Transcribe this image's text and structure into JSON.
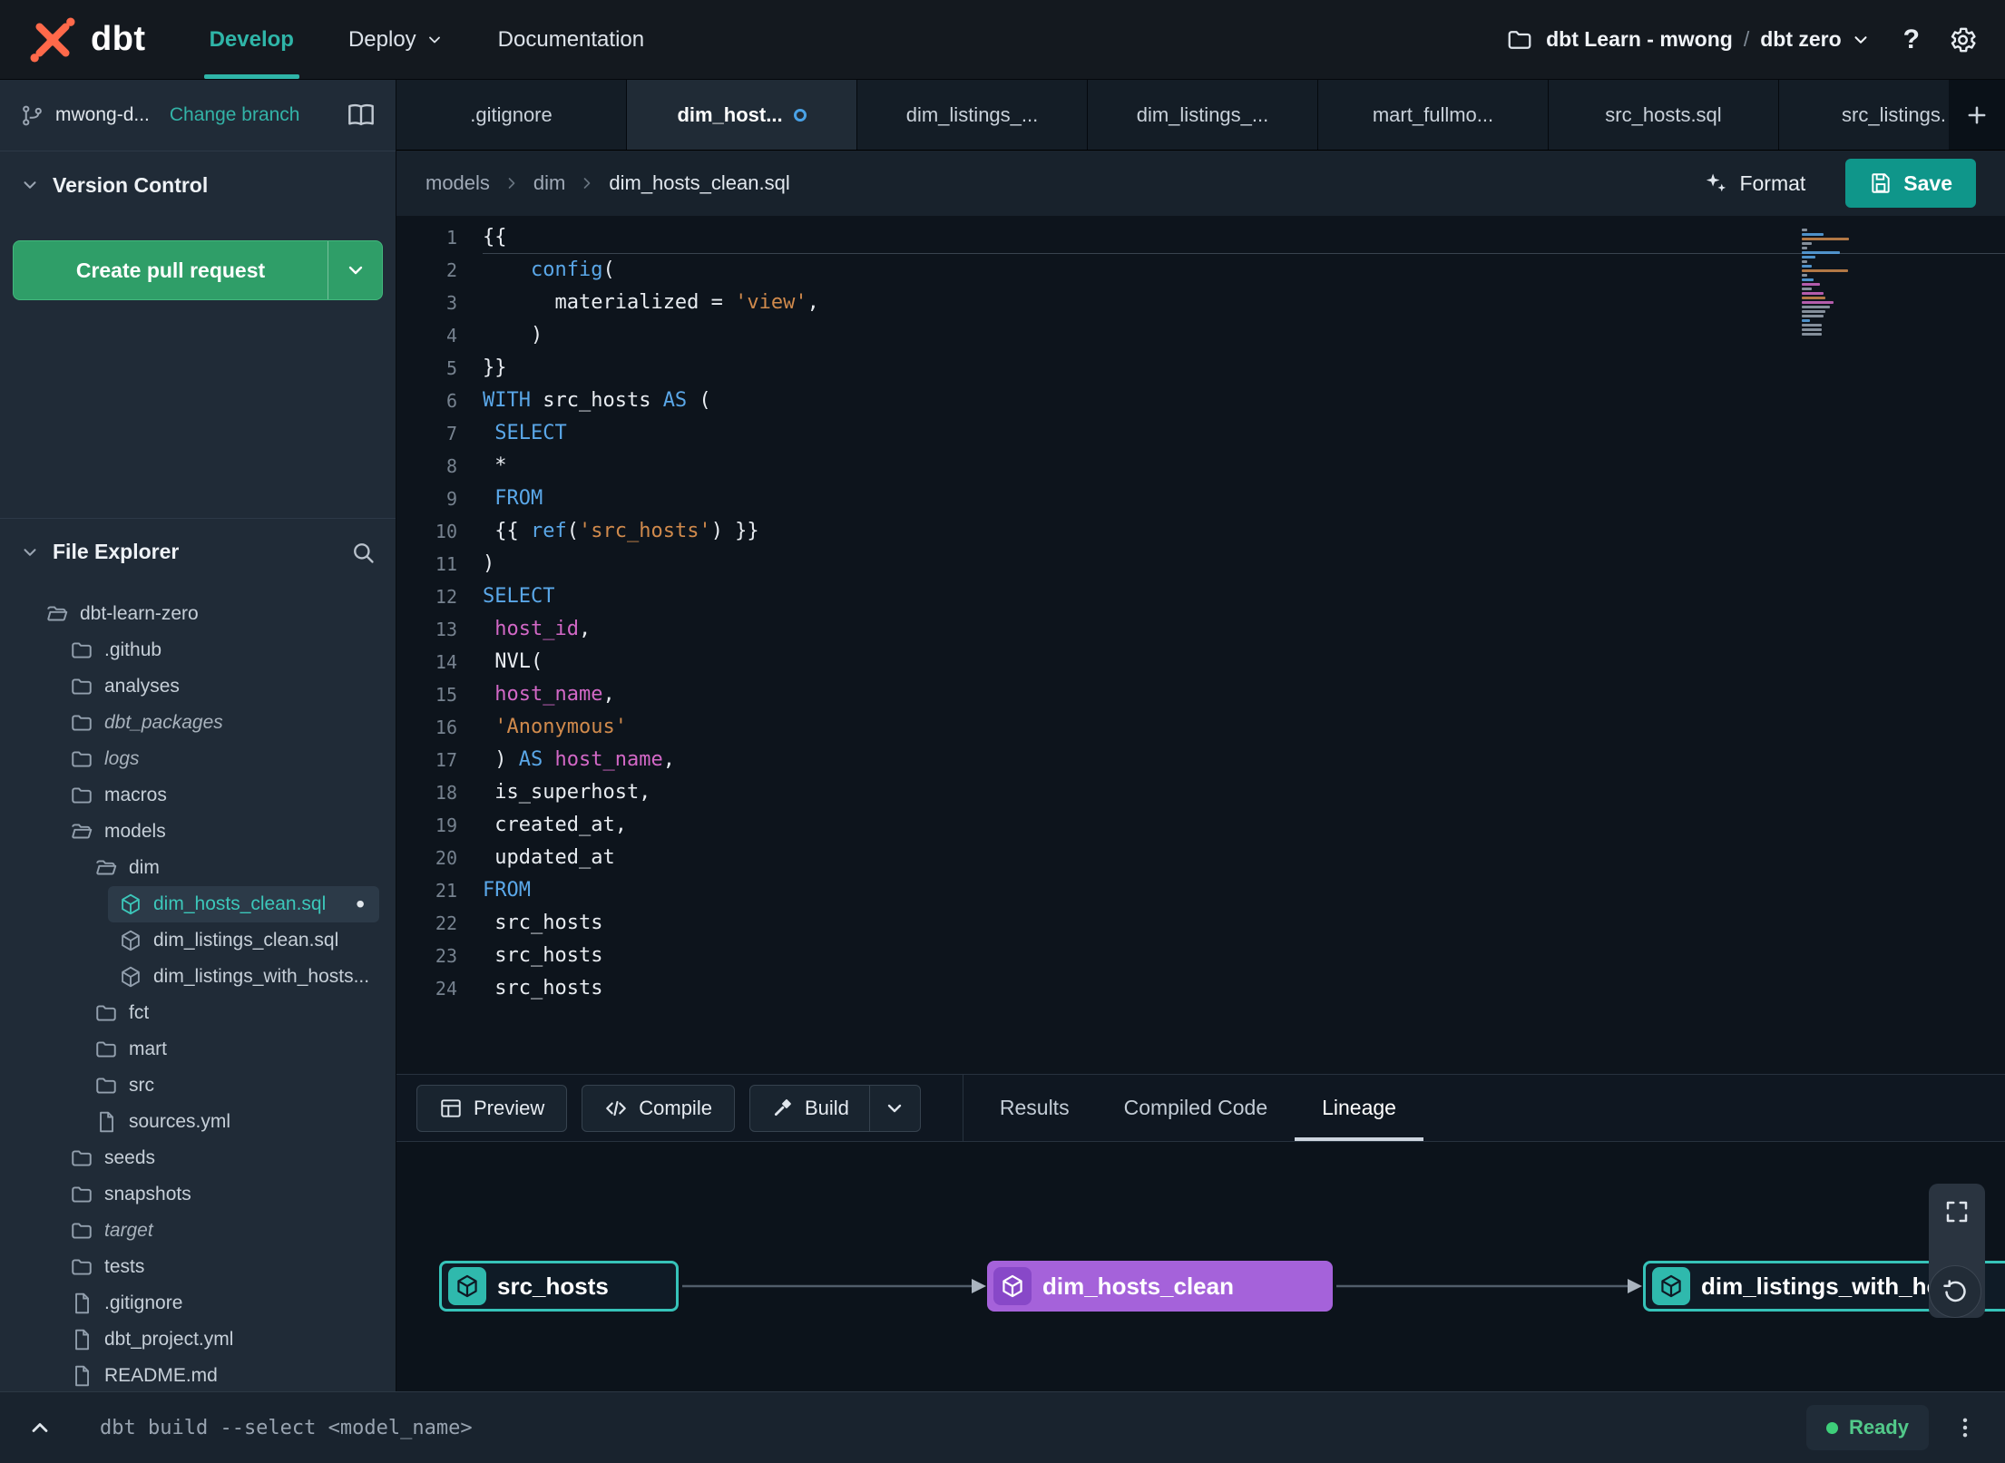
{
  "navbar": {
    "brand": "dbt",
    "items": [
      {
        "label": "Develop",
        "active": true
      },
      {
        "label": "Deploy",
        "caret": true
      },
      {
        "label": "Documentation"
      }
    ],
    "project": "dbt Learn - mwong",
    "separator": "/",
    "environment": "dbt zero",
    "help_glyph": "?"
  },
  "sidebar": {
    "branch_name": "mwong-d...",
    "change_branch": "Change branch",
    "version_control": "Version Control",
    "create_pr": "Create pull request",
    "file_explorer": "File Explorer",
    "tree": [
      {
        "label": "dbt-learn-zero",
        "icon": "folder-open",
        "level": 0
      },
      {
        "label": ".github",
        "icon": "folder",
        "level": 1
      },
      {
        "label": "analyses",
        "icon": "folder",
        "level": 1
      },
      {
        "label": "dbt_packages",
        "icon": "folder",
        "level": 1,
        "italic": true
      },
      {
        "label": "logs",
        "icon": "folder",
        "level": 1,
        "italic": true
      },
      {
        "label": "macros",
        "icon": "folder",
        "level": 1
      },
      {
        "label": "models",
        "icon": "folder-open",
        "level": 1
      },
      {
        "label": "dim",
        "icon": "folder-open",
        "level": 2
      },
      {
        "label": "dim_hosts_clean.sql",
        "icon": "cube",
        "level": 3,
        "selected": true,
        "dirty": true
      },
      {
        "label": "dim_listings_clean.sql",
        "icon": "cube",
        "level": 3
      },
      {
        "label": "dim_listings_with_hosts...",
        "icon": "cube",
        "level": 3
      },
      {
        "label": "fct",
        "icon": "folder",
        "level": 2
      },
      {
        "label": "mart",
        "icon": "folder",
        "level": 2
      },
      {
        "label": "src",
        "icon": "folder",
        "level": 2
      },
      {
        "label": "sources.yml",
        "icon": "file",
        "level": 2
      },
      {
        "label": "seeds",
        "icon": "folder",
        "level": 1
      },
      {
        "label": "snapshots",
        "icon": "folder",
        "level": 1
      },
      {
        "label": "target",
        "icon": "folder",
        "level": 1,
        "italic": true
      },
      {
        "label": "tests",
        "icon": "folder",
        "level": 1
      },
      {
        "label": ".gitignore",
        "icon": "file",
        "level": 1
      },
      {
        "label": "dbt_project.yml",
        "icon": "file",
        "level": 1
      },
      {
        "label": "README.md",
        "icon": "file",
        "level": 1
      }
    ]
  },
  "tabs": [
    {
      "label": ".gitignore"
    },
    {
      "label": "dim_host...",
      "active": true,
      "dirty": true
    },
    {
      "label": "dim_listings_..."
    },
    {
      "label": "dim_listings_..."
    },
    {
      "label": "mart_fullmo..."
    },
    {
      "label": "src_hosts.sql"
    },
    {
      "label": "src_listings."
    }
  ],
  "breadcrumb": {
    "parts": [
      "models",
      "dim",
      "dim_hosts_clean.sql"
    ],
    "format": "Format",
    "save": "Save"
  },
  "editor": {
    "lines": [
      {
        "n": 1,
        "tokens": [
          [
            "{{",
            "p"
          ]
        ]
      },
      {
        "n": 2,
        "tokens": [
          [
            "    ",
            "p"
          ],
          [
            "config",
            "k"
          ],
          [
            "(",
            "p"
          ]
        ]
      },
      {
        "n": 3,
        "tokens": [
          [
            "      ",
            "p"
          ],
          [
            "materialized = ",
            "p"
          ],
          [
            "'view'",
            "s"
          ],
          [
            ",",
            "p"
          ]
        ]
      },
      {
        "n": 4,
        "tokens": [
          [
            "    ",
            "p"
          ],
          [
            ")",
            "p"
          ]
        ]
      },
      {
        "n": 5,
        "tokens": [
          [
            "}}",
            "p"
          ]
        ]
      },
      {
        "n": 6,
        "tokens": [
          [
            "WITH",
            "k"
          ],
          [
            " src_hosts ",
            "p"
          ],
          [
            "AS",
            "k"
          ],
          [
            " (",
            "p"
          ]
        ]
      },
      {
        "n": 7,
        "tokens": [
          [
            " ",
            "p"
          ],
          [
            "SELECT",
            "k"
          ]
        ]
      },
      {
        "n": 8,
        "tokens": [
          [
            " *",
            "p"
          ]
        ]
      },
      {
        "n": 9,
        "tokens": [
          [
            " ",
            "p"
          ],
          [
            "FROM",
            "k"
          ]
        ]
      },
      {
        "n": 10,
        "tokens": [
          [
            " {{ ",
            "p"
          ],
          [
            "ref",
            "k"
          ],
          [
            "(",
            "p"
          ],
          [
            "'src_hosts'",
            "s"
          ],
          [
            ") }}",
            "p"
          ]
        ]
      },
      {
        "n": 11,
        "tokens": [
          [
            ")",
            "p"
          ]
        ]
      },
      {
        "n": 12,
        "tokens": [
          [
            "SELECT",
            "k"
          ]
        ]
      },
      {
        "n": 13,
        "tokens": [
          [
            " ",
            "p"
          ],
          [
            "host_id",
            "v"
          ],
          [
            ",",
            "p"
          ]
        ]
      },
      {
        "n": 14,
        "tokens": [
          [
            " NVL(",
            "p"
          ]
        ]
      },
      {
        "n": 15,
        "tokens": [
          [
            " ",
            "p"
          ],
          [
            "host_name",
            "v"
          ],
          [
            ",",
            "p"
          ]
        ]
      },
      {
        "n": 16,
        "tokens": [
          [
            " ",
            "p"
          ],
          [
            "'Anonymous'",
            "s"
          ]
        ]
      },
      {
        "n": 17,
        "tokens": [
          [
            " ) ",
            "p"
          ],
          [
            "AS",
            "k"
          ],
          [
            " ",
            "p"
          ],
          [
            "host_name",
            "v"
          ],
          [
            ",",
            "p"
          ]
        ]
      },
      {
        "n": 18,
        "tokens": [
          [
            " is_superhost,",
            "p"
          ]
        ]
      },
      {
        "n": 19,
        "tokens": [
          [
            " created_at,",
            "p"
          ]
        ]
      },
      {
        "n": 20,
        "tokens": [
          [
            " updated_at",
            "p"
          ]
        ]
      },
      {
        "n": 21,
        "tokens": [
          [
            "FROM",
            "k"
          ]
        ]
      },
      {
        "n": 22,
        "tokens": [
          [
            " src_hosts",
            "p"
          ]
        ]
      },
      {
        "n": 23,
        "tokens": [
          [
            " src_hosts",
            "p"
          ]
        ]
      },
      {
        "n": 24,
        "tokens": [
          [
            " src_hosts",
            "p"
          ]
        ]
      }
    ]
  },
  "actions": {
    "preview": "Preview",
    "compile": "Compile",
    "build": "Build"
  },
  "panel_tabs": [
    {
      "label": "Results"
    },
    {
      "label": "Compiled Code"
    },
    {
      "label": "Lineage",
      "active": true
    }
  ],
  "lineage": {
    "nodes": [
      {
        "label": "src_hosts",
        "kind": "teal"
      },
      {
        "label": "dim_hosts_clean",
        "kind": "purple"
      },
      {
        "label": "dim_listings_with_hosts",
        "kind": "teal"
      }
    ]
  },
  "statusbar": {
    "command": "dbt build --select <model_name>",
    "status": "Ready"
  },
  "colors": {
    "accent_teal": "#2fb5a8",
    "green_button": "#2f9e68",
    "purple_node": "#a562da",
    "teal_node_border": "#36c3b9",
    "keyword_blue": "#5aa7e8",
    "string_orange": "#d08a4c",
    "field_magenta": "#d268c6",
    "logo_orange": "#ff694a",
    "ready_green": "#3ecf7a"
  }
}
